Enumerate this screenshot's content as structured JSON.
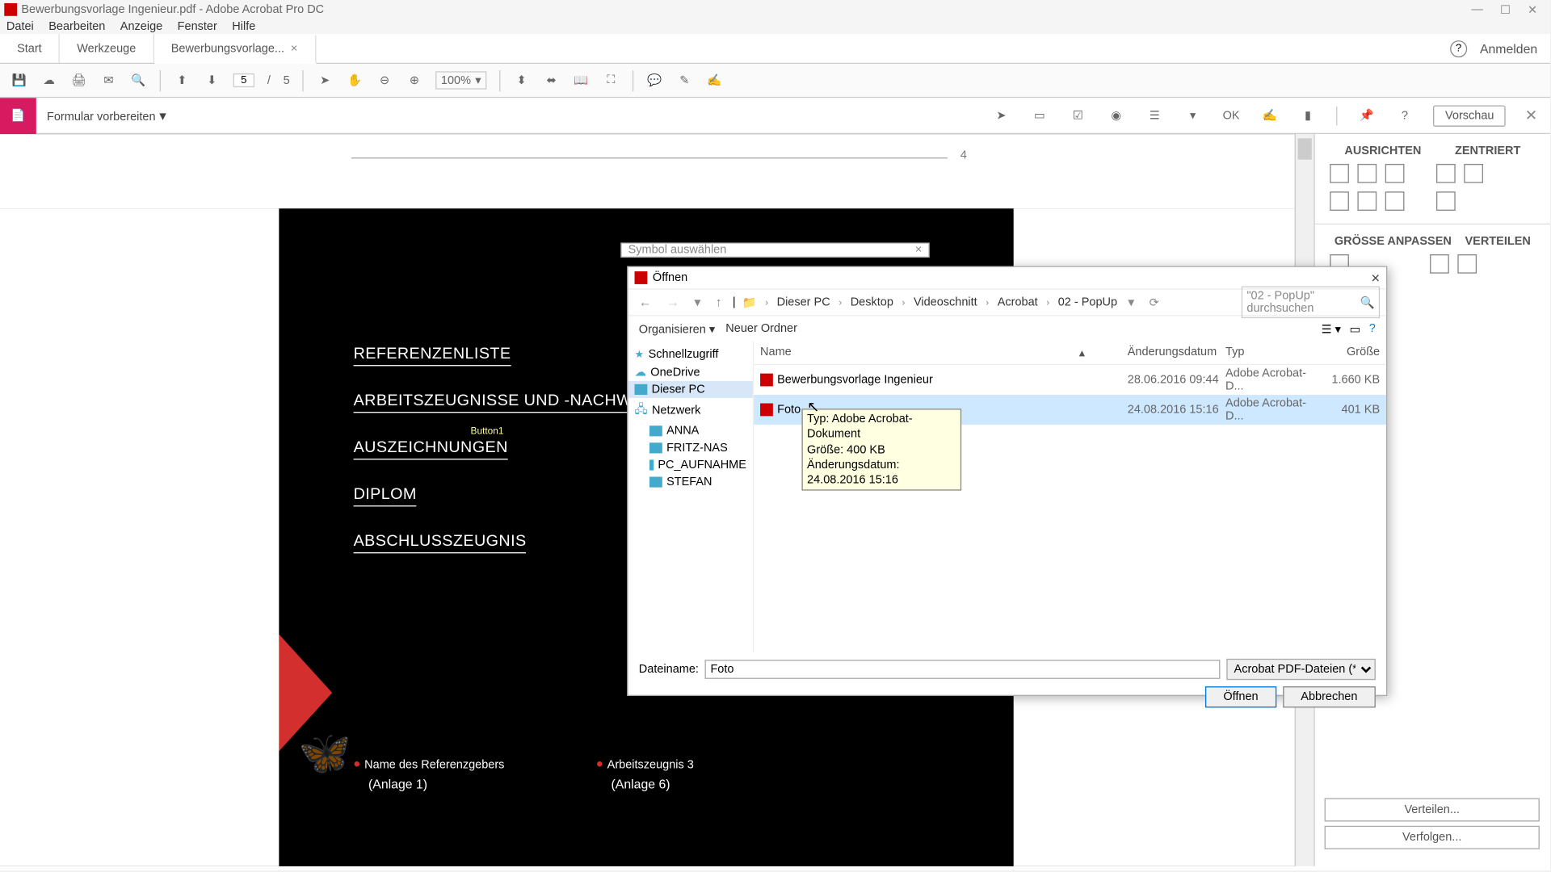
{
  "window": {
    "title": "Bewerbungsvorlage Ingenieur.pdf - Adobe Acrobat Pro DC"
  },
  "menu": [
    "Datei",
    "Bearbeiten",
    "Anzeige",
    "Fenster",
    "Hilfe"
  ],
  "tabs": {
    "start": "Start",
    "tools": "Werkzeuge",
    "doc": "Bewerbungsvorlage..."
  },
  "signin": "Anmelden",
  "toolbar": {
    "page_current": "5",
    "page_sep": "/",
    "page_total": "5",
    "zoom": "100%"
  },
  "formbar": {
    "title": "Formular vorbereiten",
    "preview": "Vorschau"
  },
  "rightpanel": {
    "align": "AUSRICHTEN",
    "center": "ZENTRIERT",
    "size": "GRÖSSE ANPASSEN",
    "distribute": "VERTEILEN",
    "distribute_btn": "Verteilen...",
    "track_btn": "Verfolgen..."
  },
  "document": {
    "page_number": "4",
    "headings": {
      "h1": "REFERENZENLISTE",
      "h2": "ARBEITSZEUGNISSE UND -NACHWEISE",
      "h3": "AUSZEICHNUNGEN",
      "h4": "DIPLOM",
      "h5": "ABSCHLUSSZEUGNIS"
    },
    "button_label": "Button1",
    "bullets": {
      "b1": "Name des Referenzgebers",
      "b1_sub": "(Anlage 1)",
      "b2": "Arbeitszeugnis 3",
      "b2_sub": "(Anlage 6)"
    }
  },
  "symbol_dialog": {
    "title": "Symbol auswählen"
  },
  "open_dialog": {
    "title": "Öffnen",
    "breadcrumbs": [
      "Dieser PC",
      "Desktop",
      "Videoschnitt",
      "Acrobat",
      "02 - PopUp"
    ],
    "search_placeholder": "\"02 - PopUp\" durchsuchen",
    "organize": "Organisieren",
    "new_folder": "Neuer Ordner",
    "tree": {
      "quick": "Schnellzugriff",
      "onedrive": "OneDrive",
      "pc": "Dieser PC",
      "network": "Netzwerk",
      "n1": "ANNA",
      "n2": "FRITZ-NAS",
      "n3": "PC_AUFNAHME",
      "n4": "STEFAN"
    },
    "columns": {
      "name": "Name",
      "date": "Änderungsdatum",
      "type": "Typ",
      "size": "Größe"
    },
    "files": [
      {
        "name": "Bewerbungsvorlage Ingenieur",
        "date": "28.06.2016 09:44",
        "type": "Adobe Acrobat-D...",
        "size": "1.660 KB"
      },
      {
        "name": "Foto",
        "date": "24.08.2016 15:16",
        "type": "Adobe Acrobat-D...",
        "size": "401 KB"
      }
    ],
    "filename_label": "Dateiname:",
    "filename_value": "Foto",
    "filter": "Acrobat PDF-Dateien (*.pdf)",
    "open_btn": "Öffnen",
    "cancel_btn": "Abbrechen"
  },
  "tooltip": {
    "l1": "Typ: Adobe Acrobat-Dokument",
    "l2": "Größe: 400 KB",
    "l3": "Änderungsdatum: 24.08.2016 15:16"
  }
}
